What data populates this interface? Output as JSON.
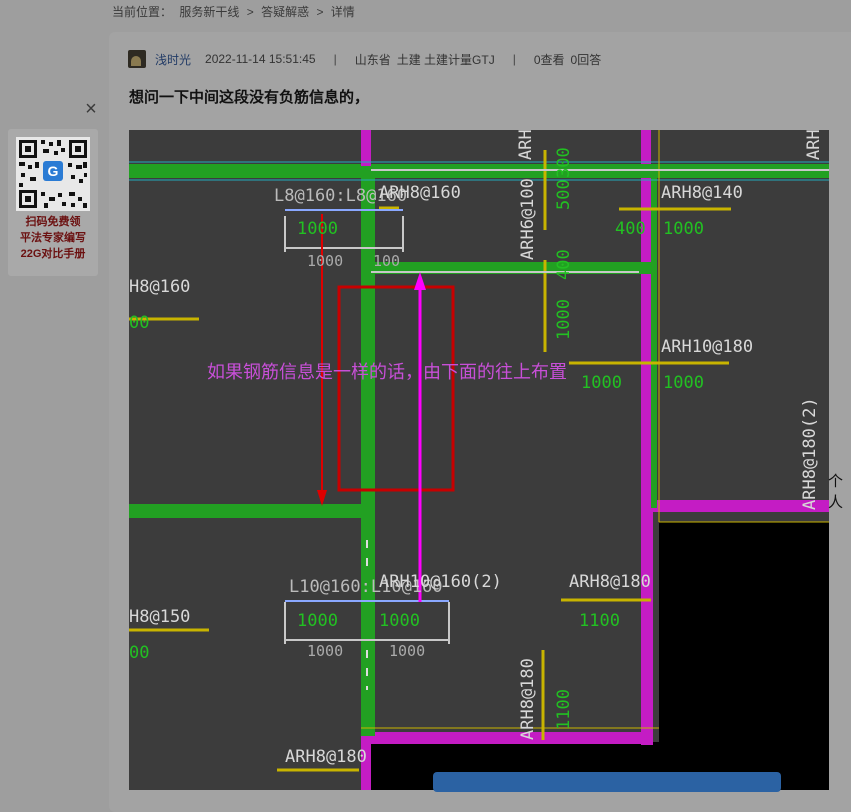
{
  "breadcrumb": {
    "label": "当前位置：",
    "items": [
      "服务新干线",
      "答疑解惑",
      "详情"
    ],
    "separator": ">"
  },
  "post": {
    "author": "浅时光",
    "datetime": "2022-11-14 15:51:45",
    "region": "山东省",
    "category": "土建 土建计量GTJ",
    "views": "0查看",
    "answers": "0回答",
    "title": "想问一下中间这段没有负筋信息的，"
  },
  "cad_labels": {
    "l8": "L8@160:L8@160",
    "l10": "L10@160:L10@160",
    "arh8_160_top": "ARH8@160",
    "arh8_140": "ARH8@140",
    "arh8_160_left": "H8@160",
    "arh8_150_left": "H8@150",
    "arh10_180": "ARH10@180",
    "arh10_160_2": "ARH10@160(2)",
    "arh8_180_mid": "ARH8@180",
    "arh8_180_bottom": "ARH8@180",
    "arh6_100": "ARH6@100",
    "arh8_180_2": "ARH8@180(2)",
    "arh_top1": "ARH",
    "arh_top2": "ARH",
    "arh8_180_vert": "ARH8@180",
    "n1000": "1000",
    "n400": "400",
    "n500": "500",
    "n1100": "1100",
    "n100": "100",
    "n300": "300",
    "n00": "00",
    "annotation": "如果钢筋信息是一样的话，由下面的往上布置"
  },
  "side_text": "个人",
  "promo": {
    "lines": [
      "扫码免费领",
      "平法专家编写",
      "22G对比手册"
    ]
  },
  "colors": {
    "cad_bg": "#3c3c3c",
    "beam_green": "#22a022",
    "magenta": "#d21cd2",
    "red": "#d20000",
    "annotation": "#c84fd8",
    "yellow": "#c8b400"
  }
}
